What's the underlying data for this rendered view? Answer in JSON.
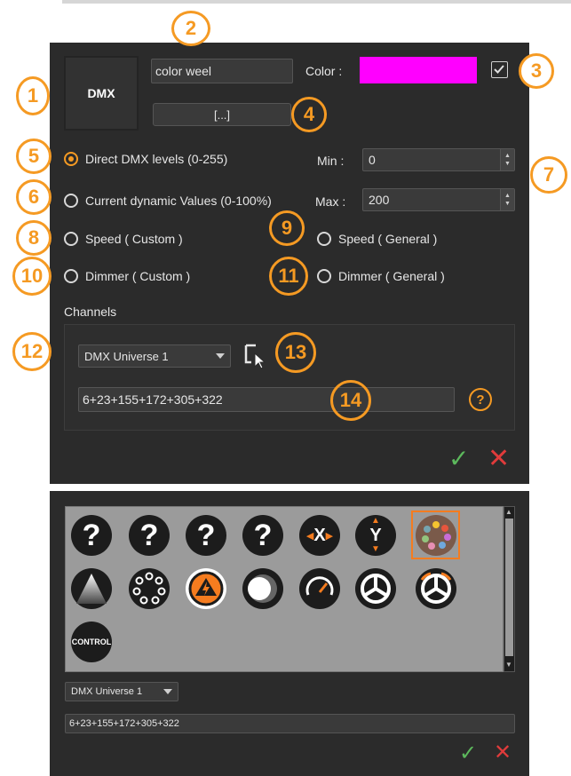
{
  "callouts": [
    "1",
    "2",
    "3",
    "4",
    "5",
    "6",
    "7",
    "8",
    "9",
    "10",
    "11",
    "12",
    "13",
    "14"
  ],
  "editor": {
    "dmx_icon_label": "DMX",
    "name_value": "color weel",
    "color_label": "Color :",
    "color_value": "#ff00ff",
    "browse_label": "[...]",
    "modes": [
      {
        "label": "Direct DMX levels (0-255)",
        "selected": true
      },
      {
        "label": "Current dynamic Values (0-100%)",
        "selected": false
      },
      {
        "label": "Speed ( Custom )",
        "selected": false
      },
      {
        "label": "Speed ( General )",
        "selected": false
      },
      {
        "label": "Dimmer ( Custom )",
        "selected": false
      },
      {
        "label": "Dimmer ( General )",
        "selected": false
      }
    ],
    "min_label": "Min :",
    "min_value": "0",
    "max_label": "Max :",
    "max_value": "200",
    "channels_label": "Channels",
    "universe": "DMX Universe 1",
    "channels_value": "6+23+155+172+305+322",
    "help_glyph": "?",
    "ok_glyph": "✓",
    "cancel_glyph": "✕"
  },
  "palette": {
    "icons": [
      {
        "name": "unknown",
        "glyph": "?"
      },
      {
        "name": "unknown",
        "glyph": "?"
      },
      {
        "name": "unknown",
        "glyph": "?"
      },
      {
        "name": "unknown",
        "glyph": "?"
      },
      {
        "name": "pan-x",
        "glyph": "X"
      },
      {
        "name": "tilt-y",
        "glyph": "Y"
      },
      {
        "name": "color-wheel",
        "glyph": ""
      },
      {
        "name": "beam",
        "glyph": ""
      },
      {
        "name": "gobo-wheel",
        "glyph": ""
      },
      {
        "name": "strobe",
        "glyph": ""
      },
      {
        "name": "dimmer",
        "glyph": ""
      },
      {
        "name": "speed",
        "glyph": ""
      },
      {
        "name": "wheel",
        "glyph": ""
      },
      {
        "name": "wheel-rotate",
        "glyph": ""
      },
      {
        "name": "control",
        "glyph": "CONTROL"
      }
    ],
    "universe": "DMX Universe 1",
    "channels_value": "6+23+155+172+305+322",
    "ok_glyph": "✓",
    "cancel_glyph": "✕"
  }
}
